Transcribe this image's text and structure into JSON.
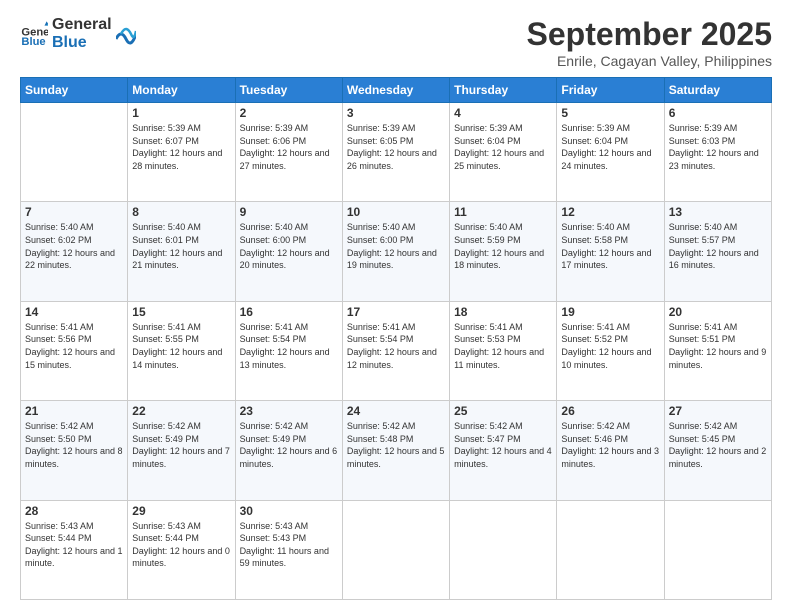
{
  "logo": {
    "text_general": "General",
    "text_blue": "Blue"
  },
  "header": {
    "month": "September 2025",
    "location": "Enrile, Cagayan Valley, Philippines"
  },
  "weekdays": [
    "Sunday",
    "Monday",
    "Tuesday",
    "Wednesday",
    "Thursday",
    "Friday",
    "Saturday"
  ],
  "weeks": [
    [
      {
        "day": "",
        "sunrise": "",
        "sunset": "",
        "daylight": ""
      },
      {
        "day": "1",
        "sunrise": "Sunrise: 5:39 AM",
        "sunset": "Sunset: 6:07 PM",
        "daylight": "Daylight: 12 hours and 28 minutes."
      },
      {
        "day": "2",
        "sunrise": "Sunrise: 5:39 AM",
        "sunset": "Sunset: 6:06 PM",
        "daylight": "Daylight: 12 hours and 27 minutes."
      },
      {
        "day": "3",
        "sunrise": "Sunrise: 5:39 AM",
        "sunset": "Sunset: 6:05 PM",
        "daylight": "Daylight: 12 hours and 26 minutes."
      },
      {
        "day": "4",
        "sunrise": "Sunrise: 5:39 AM",
        "sunset": "Sunset: 6:04 PM",
        "daylight": "Daylight: 12 hours and 25 minutes."
      },
      {
        "day": "5",
        "sunrise": "Sunrise: 5:39 AM",
        "sunset": "Sunset: 6:04 PM",
        "daylight": "Daylight: 12 hours and 24 minutes."
      },
      {
        "day": "6",
        "sunrise": "Sunrise: 5:39 AM",
        "sunset": "Sunset: 6:03 PM",
        "daylight": "Daylight: 12 hours and 23 minutes."
      }
    ],
    [
      {
        "day": "7",
        "sunrise": "Sunrise: 5:40 AM",
        "sunset": "Sunset: 6:02 PM",
        "daylight": "Daylight: 12 hours and 22 minutes."
      },
      {
        "day": "8",
        "sunrise": "Sunrise: 5:40 AM",
        "sunset": "Sunset: 6:01 PM",
        "daylight": "Daylight: 12 hours and 21 minutes."
      },
      {
        "day": "9",
        "sunrise": "Sunrise: 5:40 AM",
        "sunset": "Sunset: 6:00 PM",
        "daylight": "Daylight: 12 hours and 20 minutes."
      },
      {
        "day": "10",
        "sunrise": "Sunrise: 5:40 AM",
        "sunset": "Sunset: 6:00 PM",
        "daylight": "Daylight: 12 hours and 19 minutes."
      },
      {
        "day": "11",
        "sunrise": "Sunrise: 5:40 AM",
        "sunset": "Sunset: 5:59 PM",
        "daylight": "Daylight: 12 hours and 18 minutes."
      },
      {
        "day": "12",
        "sunrise": "Sunrise: 5:40 AM",
        "sunset": "Sunset: 5:58 PM",
        "daylight": "Daylight: 12 hours and 17 minutes."
      },
      {
        "day": "13",
        "sunrise": "Sunrise: 5:40 AM",
        "sunset": "Sunset: 5:57 PM",
        "daylight": "Daylight: 12 hours and 16 minutes."
      }
    ],
    [
      {
        "day": "14",
        "sunrise": "Sunrise: 5:41 AM",
        "sunset": "Sunset: 5:56 PM",
        "daylight": "Daylight: 12 hours and 15 minutes."
      },
      {
        "day": "15",
        "sunrise": "Sunrise: 5:41 AM",
        "sunset": "Sunset: 5:55 PM",
        "daylight": "Daylight: 12 hours and 14 minutes."
      },
      {
        "day": "16",
        "sunrise": "Sunrise: 5:41 AM",
        "sunset": "Sunset: 5:54 PM",
        "daylight": "Daylight: 12 hours and 13 minutes."
      },
      {
        "day": "17",
        "sunrise": "Sunrise: 5:41 AM",
        "sunset": "Sunset: 5:54 PM",
        "daylight": "Daylight: 12 hours and 12 minutes."
      },
      {
        "day": "18",
        "sunrise": "Sunrise: 5:41 AM",
        "sunset": "Sunset: 5:53 PM",
        "daylight": "Daylight: 12 hours and 11 minutes."
      },
      {
        "day": "19",
        "sunrise": "Sunrise: 5:41 AM",
        "sunset": "Sunset: 5:52 PM",
        "daylight": "Daylight: 12 hours and 10 minutes."
      },
      {
        "day": "20",
        "sunrise": "Sunrise: 5:41 AM",
        "sunset": "Sunset: 5:51 PM",
        "daylight": "Daylight: 12 hours and 9 minutes."
      }
    ],
    [
      {
        "day": "21",
        "sunrise": "Sunrise: 5:42 AM",
        "sunset": "Sunset: 5:50 PM",
        "daylight": "Daylight: 12 hours and 8 minutes."
      },
      {
        "day": "22",
        "sunrise": "Sunrise: 5:42 AM",
        "sunset": "Sunset: 5:49 PM",
        "daylight": "Daylight: 12 hours and 7 minutes."
      },
      {
        "day": "23",
        "sunrise": "Sunrise: 5:42 AM",
        "sunset": "Sunset: 5:49 PM",
        "daylight": "Daylight: 12 hours and 6 minutes."
      },
      {
        "day": "24",
        "sunrise": "Sunrise: 5:42 AM",
        "sunset": "Sunset: 5:48 PM",
        "daylight": "Daylight: 12 hours and 5 minutes."
      },
      {
        "day": "25",
        "sunrise": "Sunrise: 5:42 AM",
        "sunset": "Sunset: 5:47 PM",
        "daylight": "Daylight: 12 hours and 4 minutes."
      },
      {
        "day": "26",
        "sunrise": "Sunrise: 5:42 AM",
        "sunset": "Sunset: 5:46 PM",
        "daylight": "Daylight: 12 hours and 3 minutes."
      },
      {
        "day": "27",
        "sunrise": "Sunrise: 5:42 AM",
        "sunset": "Sunset: 5:45 PM",
        "daylight": "Daylight: 12 hours and 2 minutes."
      }
    ],
    [
      {
        "day": "28",
        "sunrise": "Sunrise: 5:43 AM",
        "sunset": "Sunset: 5:44 PM",
        "daylight": "Daylight: 12 hours and 1 minute."
      },
      {
        "day": "29",
        "sunrise": "Sunrise: 5:43 AM",
        "sunset": "Sunset: 5:44 PM",
        "daylight": "Daylight: 12 hours and 0 minutes."
      },
      {
        "day": "30",
        "sunrise": "Sunrise: 5:43 AM",
        "sunset": "Sunset: 5:43 PM",
        "daylight": "Daylight: 11 hours and 59 minutes."
      },
      {
        "day": "",
        "sunrise": "",
        "sunset": "",
        "daylight": ""
      },
      {
        "day": "",
        "sunrise": "",
        "sunset": "",
        "daylight": ""
      },
      {
        "day": "",
        "sunrise": "",
        "sunset": "",
        "daylight": ""
      },
      {
        "day": "",
        "sunrise": "",
        "sunset": "",
        "daylight": ""
      }
    ]
  ]
}
